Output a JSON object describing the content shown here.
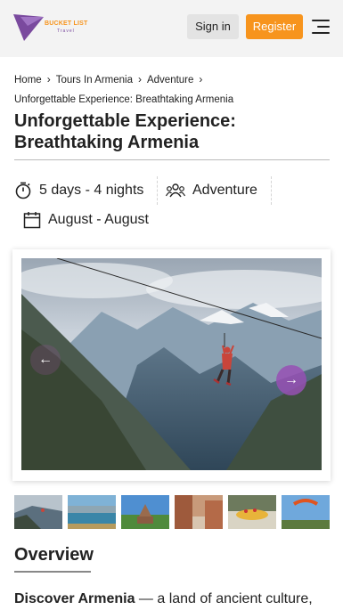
{
  "header": {
    "logo_text": "BUCKET LIST",
    "logo_sub": "Travel",
    "signin_label": "Sign in",
    "register_label": "Register"
  },
  "breadcrumb": {
    "items": [
      "Home",
      "Tours In Armenia",
      "Adventure"
    ],
    "current": "Unforgettable Experience: Breathtaking Armenia"
  },
  "page": {
    "title": "Unforgettable Experience: Breathtaking Armenia",
    "duration": "5 days - 4 nights",
    "category": "Adventure",
    "dates": "August - August"
  },
  "gallery": {
    "prev_icon": "arrow-left-icon",
    "next_icon": "arrow-right-icon",
    "thumbnails": [
      "zipline",
      "lake",
      "monastery",
      "old-town",
      "rafting",
      "paragliding"
    ]
  },
  "overview": {
    "heading": "Overview",
    "intro_bold": "Discover Armenia",
    "intro_text": " — a land of ancient culture,"
  },
  "colors": {
    "accent": "#f7941d",
    "brand_purple": "#7a4a9e",
    "arrow_purple": "#9650b4"
  }
}
